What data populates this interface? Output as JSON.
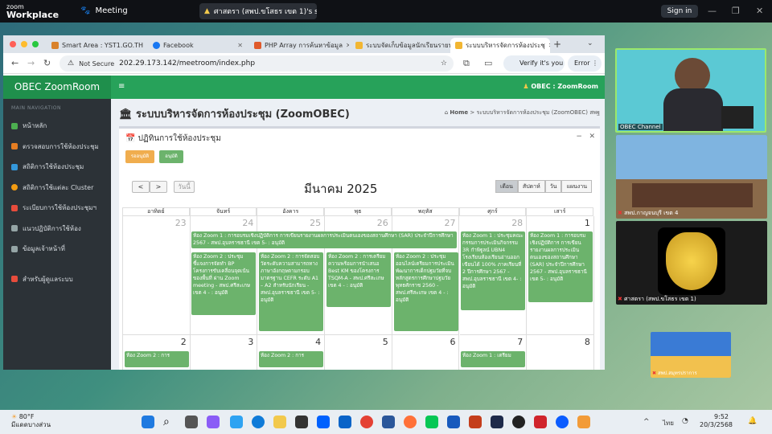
{
  "zoom": {
    "logo_small": "zoom",
    "logo_big": "Workplace",
    "meeting": "Meeting",
    "share_label": "ศาสตรา (สพป.ขโสธร เขต 1)'s screer",
    "sign_in": "Sign in"
  },
  "browser": {
    "tabs": [
      {
        "label": "Smart Area : YST1.GO.TH",
        "color": "#d9822b"
      },
      {
        "label": "Facebook",
        "color": "#1877f2"
      },
      {
        "label": "PHP Array การค้นหาข้อมูล",
        "color": "#e05a2b"
      },
      {
        "label": "ระบบจัดเก็บข้อมูลนักเรียนรายบุค",
        "color": "#f2b632"
      },
      {
        "label": "ระบบบริหารจัดการห้องประชุ",
        "color": "#f2b632"
      }
    ],
    "not_secure": "Not Secure",
    "url": "202.29.173.142/meetroom/index.php",
    "verify": "Verify it's you",
    "error": "Error"
  },
  "app": {
    "brand": "OBEC ZoomRoom",
    "right_title": "OBEC : ZoomRoom",
    "nav_header": "MAIN NAVIGATION",
    "nav": [
      {
        "label": "หน้าหลัก",
        "color": "#4caf50"
      },
      {
        "label": "ตรวจสอบการใช้ห้องประชุม",
        "color": "#e67e22"
      },
      {
        "label": "สถิติการใช้ห้องประชุม",
        "color": "#3498db"
      },
      {
        "label": "สถิติการใช้แต่ละ Cluster",
        "color": "#f39c12"
      },
      {
        "label": "ระเบียบการใช้ห้องประชุมฯ",
        "color": "#e74c3c"
      },
      {
        "label": "แนวปฏิบัติการใช้ห้อง",
        "color": "#95a5a6"
      },
      {
        "label": "ข้อมูลเจ้าหน้าที่",
        "color": "#95a5a6"
      },
      {
        "label": "สำหรับผู้ดูแลระบบ",
        "color": "#e74c3c"
      }
    ],
    "page_title": "ระบบบริหารจัดการห้องประชุม (ZoomOBEC)",
    "breadcrumb_home": "Home",
    "breadcrumb_current": "ระบบบริหารจัดการห้องประชุม (ZoomOBEC) สพฐ",
    "box_title": "ปฏิทินการใช้ห้องประชุม",
    "legend_pending": "รออนุมัติ",
    "legend_approved": "อนุมัติ",
    "prev": "<",
    "next": ">",
    "today": "วันนี้",
    "month_title": "มีนาคม 2025",
    "views": [
      "เดือน",
      "สัปดาห์",
      "วัน",
      "แผนงาน"
    ],
    "weekdays": [
      "อาทิตย์",
      "จันทร์",
      "อังคาร",
      "พุธ",
      "พฤหัส",
      "ศุกร์",
      "เสาร์"
    ],
    "week1_days": [
      "23",
      "24",
      "25",
      "26",
      "27",
      "28",
      "1"
    ],
    "week2_days": [
      "2",
      "3",
      "4",
      "5",
      "6",
      "7",
      "8"
    ],
    "events": {
      "span": "ห้อง Zoom 1 : การอบรมเชิงปฏิบัติการ การเขียนรายงานผลการประเมินตนเองของสถานศึกษา (SAR) ประจำปีการศึกษา 2567 - สพป.อุบลราชธานี เขต 5- : อนุมัติ",
      "fri": "ห้อง Zoom 1 : ประชุมคณะกรรมการประเมินกิจกรรม 3R กำพิฐูลน์ UBN4 โรงเรียนห้องเรียนอ่านออกเขียนได้ 100% ภาคเรียนที่ 2 ปีการศึกษา 2567 - สพป.อุบลราชธานี เขต 4- : อนุมัติ",
      "sat": "ห้อง Zoom 1 : การอบรมเชิงปฏิบัติการ การเขียนรายงานผลการประเมินตนเองของสถานศึกษา (SAR) ประจำปีการศึกษา 2567 - สพป.อุบลราชธานี เขต 5- : อนุมัติ",
      "mon": "ห้อง Zoom 2 : ประชุมชี้แจงการจัดทำ BP โครงการขับเคลื่อนจุดเน้นของพื้นที่ ผ่าน Zoom meeting - สพป.ศรีสะเกษ เขต 4 - : อนุมัติ",
      "tue": "ห้อง Zoom 2 : การจัดสอบวัดระดับความสามารถทางภาษาอังกฤษตามกรอบมาตรฐาน CEFR ระดับ A1 – A2 สำหรับนักเรียน - สพป.อุบลราชธานี เขต 5- : อนุมัติ",
      "wed": "ห้อง Zoom 2 : การเตรียมความพร้อมการนำเสนอ Best KM ของโครงการ TSQM-A - สพป.ศรีสะเกษ เขต 4 - : อนุมัติ",
      "thu": "ห้อง Zoom 2 : ประชุมออนไลน์เตรียมการประเมินพัฒนาการเด็กปฐมวัยที่จบหลักสูตรการศึกษาปฐมวัย พุทธศักราช 2560 - สพป.ศรีสะเกษ เขต 4 - : อนุมัติ",
      "w2sun": "ห้อง Zoom 2 : การ",
      "w2tue": "ห้อง Zoom 2 : การ",
      "w2fri": "ห้อง Zoom 1 : เตรียม"
    }
  },
  "participants": [
    {
      "label": "OBEC Channel"
    },
    {
      "label": "สพป.กาญจนบุรี เขต 4"
    },
    {
      "label": "ศาสตรา (สพป.ขโสธร เขต 1)"
    },
    {
      "label": "สพป.สมุทรปราการ"
    }
  ],
  "taskbar": {
    "temp": "80°F",
    "weather": "มีแดดบางส่วน",
    "lang": "ไทย",
    "time": "9:52",
    "date": "20/3/2568"
  }
}
